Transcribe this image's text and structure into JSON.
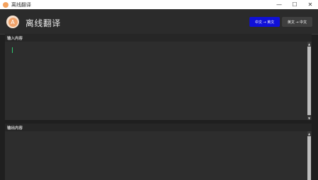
{
  "window": {
    "title": "离线翻译",
    "controls": {
      "minimize": "—",
      "maximize": "☐",
      "close": "✕"
    }
  },
  "header": {
    "logo_letter": "A",
    "app_title": "离线翻译",
    "buttons": [
      {
        "label": "中文 → 英文",
        "active": true
      },
      {
        "label": "英文 → 中文",
        "active": false
      }
    ]
  },
  "input_panel": {
    "label": "输入内容",
    "value": ""
  },
  "output_panel": {
    "label": "输出内容",
    "value": ""
  },
  "colors": {
    "accent_blue": "#1010d8",
    "caret_green": "#2ecc71",
    "logo_orange": "#f0a26a"
  }
}
